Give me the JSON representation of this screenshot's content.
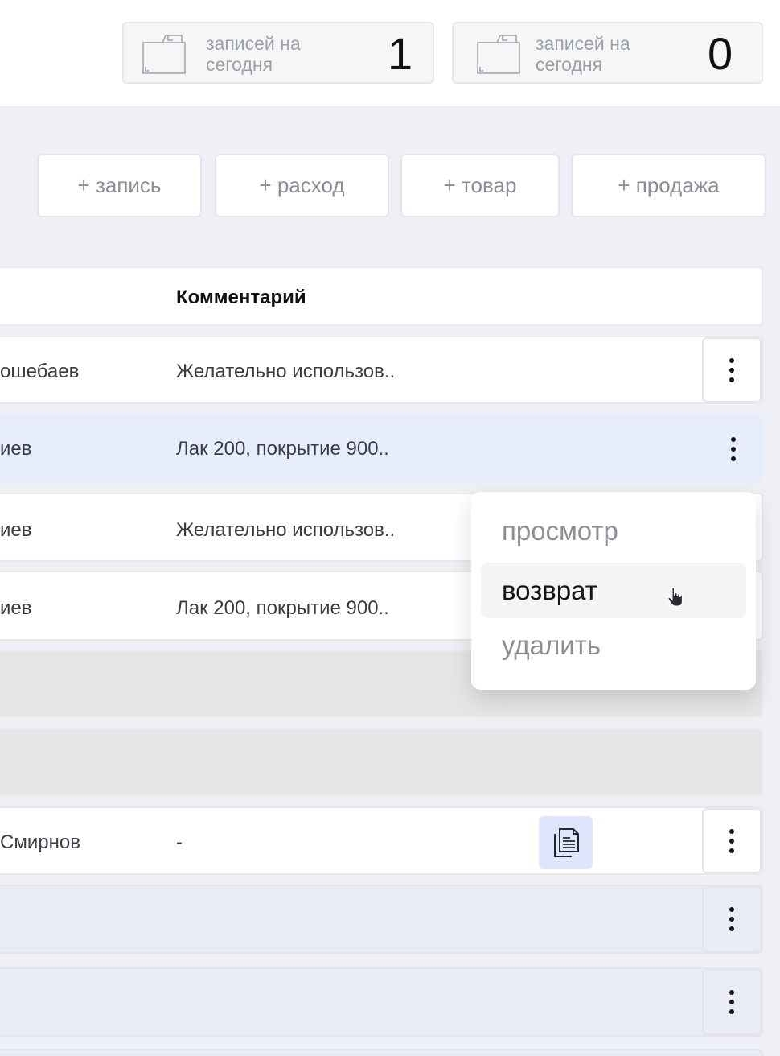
{
  "stats": [
    {
      "label": "записей на сегодня",
      "value": "1",
      "icon": "folder-icon"
    },
    {
      "label": "записей на сегодня",
      "value": "0",
      "icon": "folder-icon"
    }
  ],
  "actions": {
    "add_record": "+ запись",
    "add_expense": "+ расход",
    "add_product": "+ товар",
    "add_sale": "+ продажа"
  },
  "table": {
    "header_comment": "Комментарий",
    "rows": [
      {
        "name": "ошебаев",
        "comment": "Желательно использов.."
      },
      {
        "name": "иев",
        "comment": "Лак 200, покрытие 900.."
      },
      {
        "name": "иев",
        "comment": "Желательно использов.."
      },
      {
        "name": "иев",
        "comment": "Лак 200, покрытие 900.."
      },
      {
        "name": "Смирнов",
        "comment": "-"
      }
    ]
  },
  "context_menu": {
    "items": [
      "просмотр",
      "возврат",
      "удалить"
    ],
    "hovered": "возврат"
  },
  "colors": {
    "accent_blue": "#e7edfb",
    "doc_button": "#dde6fb",
    "row_gray": "#e6e6e6",
    "row_lavender": "#e9ebf6"
  }
}
